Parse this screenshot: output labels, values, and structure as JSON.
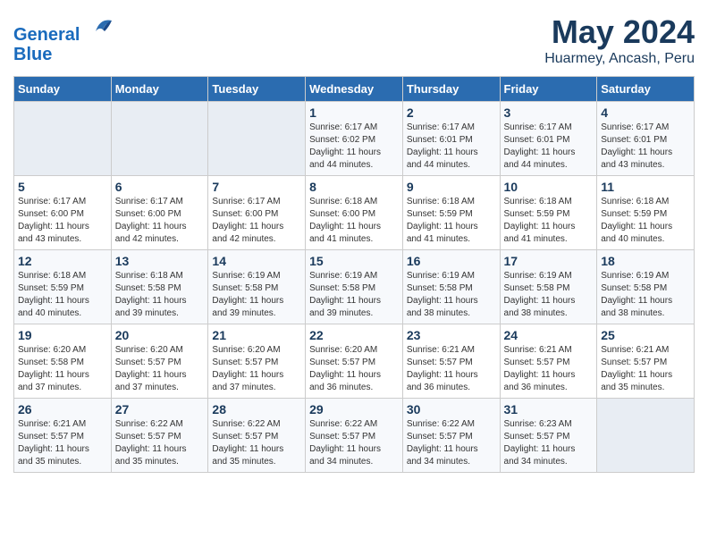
{
  "header": {
    "logo_line1": "General",
    "logo_line2": "Blue",
    "title": "May 2024",
    "subtitle": "Huarmey, Ancash, Peru"
  },
  "weekdays": [
    "Sunday",
    "Monday",
    "Tuesday",
    "Wednesday",
    "Thursday",
    "Friday",
    "Saturday"
  ],
  "weeks": [
    [
      {
        "day": "",
        "info": ""
      },
      {
        "day": "",
        "info": ""
      },
      {
        "day": "",
        "info": ""
      },
      {
        "day": "1",
        "info": "Sunrise: 6:17 AM\nSunset: 6:02 PM\nDaylight: 11 hours\nand 44 minutes."
      },
      {
        "day": "2",
        "info": "Sunrise: 6:17 AM\nSunset: 6:01 PM\nDaylight: 11 hours\nand 44 minutes."
      },
      {
        "day": "3",
        "info": "Sunrise: 6:17 AM\nSunset: 6:01 PM\nDaylight: 11 hours\nand 44 minutes."
      },
      {
        "day": "4",
        "info": "Sunrise: 6:17 AM\nSunset: 6:01 PM\nDaylight: 11 hours\nand 43 minutes."
      }
    ],
    [
      {
        "day": "5",
        "info": "Sunrise: 6:17 AM\nSunset: 6:00 PM\nDaylight: 11 hours\nand 43 minutes."
      },
      {
        "day": "6",
        "info": "Sunrise: 6:17 AM\nSunset: 6:00 PM\nDaylight: 11 hours\nand 42 minutes."
      },
      {
        "day": "7",
        "info": "Sunrise: 6:17 AM\nSunset: 6:00 PM\nDaylight: 11 hours\nand 42 minutes."
      },
      {
        "day": "8",
        "info": "Sunrise: 6:18 AM\nSunset: 6:00 PM\nDaylight: 11 hours\nand 41 minutes."
      },
      {
        "day": "9",
        "info": "Sunrise: 6:18 AM\nSunset: 5:59 PM\nDaylight: 11 hours\nand 41 minutes."
      },
      {
        "day": "10",
        "info": "Sunrise: 6:18 AM\nSunset: 5:59 PM\nDaylight: 11 hours\nand 41 minutes."
      },
      {
        "day": "11",
        "info": "Sunrise: 6:18 AM\nSunset: 5:59 PM\nDaylight: 11 hours\nand 40 minutes."
      }
    ],
    [
      {
        "day": "12",
        "info": "Sunrise: 6:18 AM\nSunset: 5:59 PM\nDaylight: 11 hours\nand 40 minutes."
      },
      {
        "day": "13",
        "info": "Sunrise: 6:18 AM\nSunset: 5:58 PM\nDaylight: 11 hours\nand 39 minutes."
      },
      {
        "day": "14",
        "info": "Sunrise: 6:19 AM\nSunset: 5:58 PM\nDaylight: 11 hours\nand 39 minutes."
      },
      {
        "day": "15",
        "info": "Sunrise: 6:19 AM\nSunset: 5:58 PM\nDaylight: 11 hours\nand 39 minutes."
      },
      {
        "day": "16",
        "info": "Sunrise: 6:19 AM\nSunset: 5:58 PM\nDaylight: 11 hours\nand 38 minutes."
      },
      {
        "day": "17",
        "info": "Sunrise: 6:19 AM\nSunset: 5:58 PM\nDaylight: 11 hours\nand 38 minutes."
      },
      {
        "day": "18",
        "info": "Sunrise: 6:19 AM\nSunset: 5:58 PM\nDaylight: 11 hours\nand 38 minutes."
      }
    ],
    [
      {
        "day": "19",
        "info": "Sunrise: 6:20 AM\nSunset: 5:58 PM\nDaylight: 11 hours\nand 37 minutes."
      },
      {
        "day": "20",
        "info": "Sunrise: 6:20 AM\nSunset: 5:57 PM\nDaylight: 11 hours\nand 37 minutes."
      },
      {
        "day": "21",
        "info": "Sunrise: 6:20 AM\nSunset: 5:57 PM\nDaylight: 11 hours\nand 37 minutes."
      },
      {
        "day": "22",
        "info": "Sunrise: 6:20 AM\nSunset: 5:57 PM\nDaylight: 11 hours\nand 36 minutes."
      },
      {
        "day": "23",
        "info": "Sunrise: 6:21 AM\nSunset: 5:57 PM\nDaylight: 11 hours\nand 36 minutes."
      },
      {
        "day": "24",
        "info": "Sunrise: 6:21 AM\nSunset: 5:57 PM\nDaylight: 11 hours\nand 36 minutes."
      },
      {
        "day": "25",
        "info": "Sunrise: 6:21 AM\nSunset: 5:57 PM\nDaylight: 11 hours\nand 35 minutes."
      }
    ],
    [
      {
        "day": "26",
        "info": "Sunrise: 6:21 AM\nSunset: 5:57 PM\nDaylight: 11 hours\nand 35 minutes."
      },
      {
        "day": "27",
        "info": "Sunrise: 6:22 AM\nSunset: 5:57 PM\nDaylight: 11 hours\nand 35 minutes."
      },
      {
        "day": "28",
        "info": "Sunrise: 6:22 AM\nSunset: 5:57 PM\nDaylight: 11 hours\nand 35 minutes."
      },
      {
        "day": "29",
        "info": "Sunrise: 6:22 AM\nSunset: 5:57 PM\nDaylight: 11 hours\nand 34 minutes."
      },
      {
        "day": "30",
        "info": "Sunrise: 6:22 AM\nSunset: 5:57 PM\nDaylight: 11 hours\nand 34 minutes."
      },
      {
        "day": "31",
        "info": "Sunrise: 6:23 AM\nSunset: 5:57 PM\nDaylight: 11 hours\nand 34 minutes."
      },
      {
        "day": "",
        "info": ""
      }
    ]
  ]
}
